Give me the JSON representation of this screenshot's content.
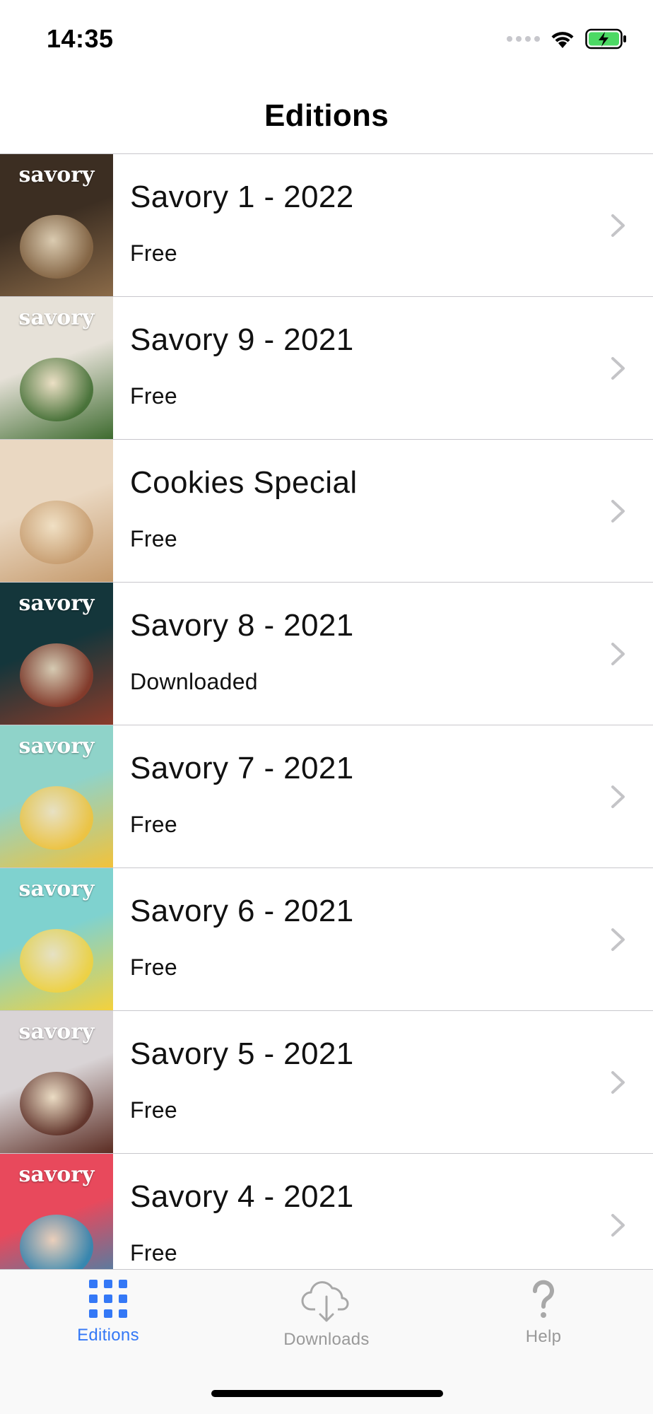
{
  "status_bar": {
    "time": "14:35"
  },
  "nav": {
    "title": "Editions"
  },
  "editions": [
    {
      "title": "Savory 1 - 2022",
      "status": "Free",
      "cover_brand": "savory",
      "cover_colors": [
        "#3c2e22",
        "#8a6a48"
      ]
    },
    {
      "title": "Savory 9 - 2021",
      "status": "Free",
      "cover_brand": "savory",
      "cover_colors": [
        "#e6e1d8",
        "#3e6b2f"
      ]
    },
    {
      "title": "Cookies Special",
      "status": "Free",
      "cover_brand": "",
      "cover_colors": [
        "#ead8c2",
        "#c59a6c"
      ]
    },
    {
      "title": "Savory 8 - 2021",
      "status": "Downloaded",
      "cover_brand": "savory",
      "cover_colors": [
        "#14363b",
        "#8a3b2a"
      ]
    },
    {
      "title": "Savory 7 - 2021",
      "status": "Free",
      "cover_brand": "savory",
      "cover_colors": [
        "#8fd3c9",
        "#f2c23a"
      ]
    },
    {
      "title": "Savory 6 - 2021",
      "status": "Free",
      "cover_brand": "savory",
      "cover_colors": [
        "#7fd2cf",
        "#f4d13c"
      ]
    },
    {
      "title": "Savory 5 - 2021",
      "status": "Free",
      "cover_brand": "savory",
      "cover_colors": [
        "#d9d4d6",
        "#5b2c22"
      ]
    },
    {
      "title": "Savory 4 - 2021",
      "status": "Free",
      "cover_brand": "savory",
      "cover_colors": [
        "#e8495c",
        "#2a8bb5"
      ]
    }
  ],
  "tabs": [
    {
      "label": "Editions",
      "icon": "grid-icon",
      "active": true
    },
    {
      "label": "Downloads",
      "icon": "cloud-download-icon",
      "active": false
    },
    {
      "label": "Help",
      "icon": "question-mark-icon",
      "active": false
    }
  ],
  "colors": {
    "accent": "#3478f6",
    "inactive": "#999999",
    "separator": "#c8c7cc",
    "chevron": "#c4c4c7",
    "battery_green": "#4cd964"
  }
}
